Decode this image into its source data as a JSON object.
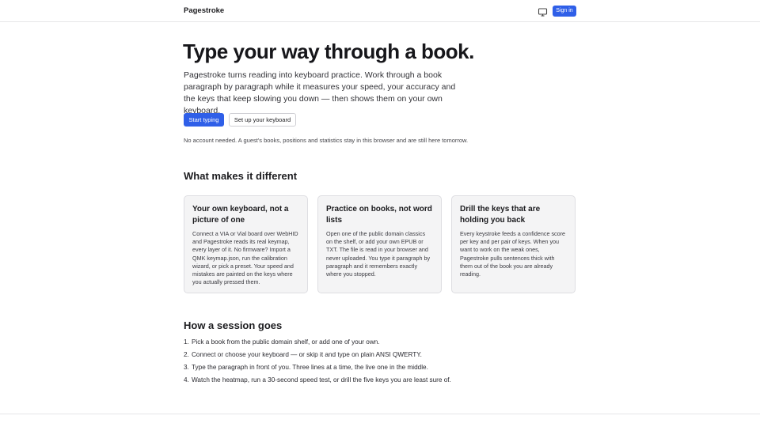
{
  "header": {
    "brand": "Pagestroke",
    "display_icon": "monitor-icon",
    "sign_in_label": "Sign in"
  },
  "hero": {
    "title": "Type your way through a book.",
    "description": "Pagestroke turns reading into keyboard practice. Work through a book paragraph by paragraph while it measures your speed, your accuracy and the keys that keep slowing you down — then shows them on your own keyboard.",
    "start_label": "Start typing",
    "setup_label": "Set up your keyboard",
    "note": "No account needed. A guest's books, positions and statistics stay in this browser and are still here tomorrow."
  },
  "features": {
    "title": "What makes it different",
    "cards": [
      {
        "title": "Your own keyboard, not a picture of one",
        "body": "Connect a VIA or Vial board over WebHID and Pagestroke reads its real keymap, every layer of it. No firmware? Import a QMK keymap.json, run the calibration wizard, or pick a preset. Your speed and mistakes are painted on the keys where you actually pressed them."
      },
      {
        "title": "Practice on books, not word lists",
        "body": "Open one of the public domain classics on the shelf, or add your own EPUB or TXT. The file is read in your browser and never uploaded. You type it paragraph by paragraph and it remembers exactly where you stopped."
      },
      {
        "title": "Drill the keys that are holding you back",
        "body": "Every keystroke feeds a confidence score per key and per pair of keys. When you want to work on the weak ones, Pagestroke pulls sentences thick with them out of the book you are already reading."
      }
    ]
  },
  "session": {
    "title": "How a session goes",
    "steps": [
      "Pick a book from the public domain shelf, or add one of your own.",
      "Connect or choose your keyboard — or skip it and type on plain ANSI QWERTY.",
      "Type the paragraph in front of you. Three lines at a time, the live one in the middle.",
      "Watch the heatmap, run a 30-second speed test, or drill the five keys you are least sure of."
    ]
  },
  "colors": {
    "accent": "#2f5fe8",
    "card_bg": "#f4f4f5",
    "border": "#dedee2"
  }
}
